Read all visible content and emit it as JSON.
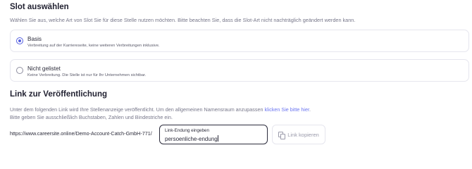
{
  "slot": {
    "title": "Slot auswählen",
    "subtitle": "Wählen Sie aus, welche Art von Slot Sie für diese Stelle nutzen möchten. Bitte beachten Sie, dass die Slot-Art nicht nachträglich geändert werden kann.",
    "options": [
      {
        "title": "Basis",
        "description": "Verbreitung auf der Karriereseite, keine weiteren Verbreitungen inklusive.",
        "selected": true
      },
      {
        "title": "Nicht gelistet",
        "description": "Keine Verbreitung. Die Stelle ist nur für Ihr Unternehmen sichtbar.",
        "selected": false
      }
    ]
  },
  "link": {
    "title": "Link zur Veröffentlichung",
    "description_part1": "Unter dem folgenden Link wird Ihre Stellenanzeige veröffentlicht. Um den allgemeinen Namensraum anzupassen",
    "description_link": "klicken Sie bitte hier",
    "description_part2": ".",
    "description_line2": "Bitte geben Sie ausschließlich Buchstaben, Zahlen und Bindestriche ein.",
    "url_prefix": "https://www.careersite.online/Demo-Account-Catch-GmbH-771/",
    "input_label": "Link-Endung eingeben",
    "input_value": "persoenliche-endung",
    "copy_button": "Link kopieren",
    "link_color": "#6a74f0"
  },
  "colors": {
    "accent": "#5560e0"
  }
}
